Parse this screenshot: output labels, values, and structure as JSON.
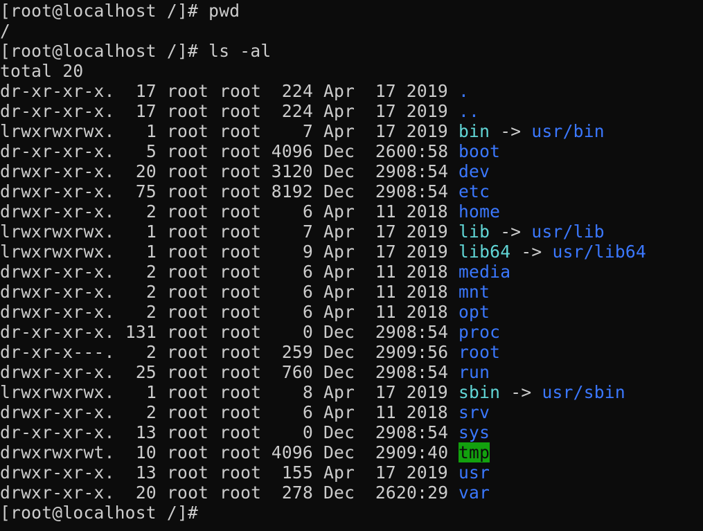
{
  "terminal": {
    "prompt": "[root@localhost /]#",
    "command1": "pwd",
    "output1": "/",
    "command2": "ls -al",
    "total": "total 20",
    "colors": {
      "background": "#0c0c0c",
      "text": "#cccccc",
      "directory": "#3b78ff",
      "symlink": "#61d6d6",
      "sticky_bg": "#13a10e"
    },
    "entries": [
      {
        "perms": "dr-xr-xr-x.",
        "links": "17",
        "owner": "root",
        "group": "root",
        "size": "224",
        "month": "Apr",
        "day": "17",
        "time": "2019",
        "name": ".",
        "kind": "dir",
        "target": ""
      },
      {
        "perms": "dr-xr-xr-x.",
        "links": "17",
        "owner": "root",
        "group": "root",
        "size": "224",
        "month": "Apr",
        "day": "17",
        "time": "2019",
        "name": "..",
        "kind": "dir",
        "target": ""
      },
      {
        "perms": "lrwxrwxrwx.",
        "links": "1",
        "owner": "root",
        "group": "root",
        "size": "7",
        "month": "Apr",
        "day": "17",
        "time": "2019",
        "name": "bin",
        "kind": "link",
        "target": "usr/bin"
      },
      {
        "perms": "dr-xr-xr-x.",
        "links": "5",
        "owner": "root",
        "group": "root",
        "size": "4096",
        "month": "Dec",
        "day": "26",
        "time": "00:58",
        "name": "boot",
        "kind": "dir",
        "target": ""
      },
      {
        "perms": "drwxr-xr-x.",
        "links": "20",
        "owner": "root",
        "group": "root",
        "size": "3120",
        "month": "Dec",
        "day": "29",
        "time": "08:54",
        "name": "dev",
        "kind": "dir",
        "target": ""
      },
      {
        "perms": "drwxr-xr-x.",
        "links": "75",
        "owner": "root",
        "group": "root",
        "size": "8192",
        "month": "Dec",
        "day": "29",
        "time": "08:54",
        "name": "etc",
        "kind": "dir",
        "target": ""
      },
      {
        "perms": "drwxr-xr-x.",
        "links": "2",
        "owner": "root",
        "group": "root",
        "size": "6",
        "month": "Apr",
        "day": "11",
        "time": "2018",
        "name": "home",
        "kind": "dir",
        "target": ""
      },
      {
        "perms": "lrwxrwxrwx.",
        "links": "1",
        "owner": "root",
        "group": "root",
        "size": "7",
        "month": "Apr",
        "day": "17",
        "time": "2019",
        "name": "lib",
        "kind": "link",
        "target": "usr/lib"
      },
      {
        "perms": "lrwxrwxrwx.",
        "links": "1",
        "owner": "root",
        "group": "root",
        "size": "9",
        "month": "Apr",
        "day": "17",
        "time": "2019",
        "name": "lib64",
        "kind": "link",
        "target": "usr/lib64"
      },
      {
        "perms": "drwxr-xr-x.",
        "links": "2",
        "owner": "root",
        "group": "root",
        "size": "6",
        "month": "Apr",
        "day": "11",
        "time": "2018",
        "name": "media",
        "kind": "dir",
        "target": ""
      },
      {
        "perms": "drwxr-xr-x.",
        "links": "2",
        "owner": "root",
        "group": "root",
        "size": "6",
        "month": "Apr",
        "day": "11",
        "time": "2018",
        "name": "mnt",
        "kind": "dir",
        "target": ""
      },
      {
        "perms": "drwxr-xr-x.",
        "links": "2",
        "owner": "root",
        "group": "root",
        "size": "6",
        "month": "Apr",
        "day": "11",
        "time": "2018",
        "name": "opt",
        "kind": "dir",
        "target": ""
      },
      {
        "perms": "dr-xr-xr-x.",
        "links": "131",
        "owner": "root",
        "group": "root",
        "size": "0",
        "month": "Dec",
        "day": "29",
        "time": "08:54",
        "name": "proc",
        "kind": "dir",
        "target": ""
      },
      {
        "perms": "dr-xr-x---.",
        "links": "2",
        "owner": "root",
        "group": "root",
        "size": "259",
        "month": "Dec",
        "day": "29",
        "time": "09:56",
        "name": "root",
        "kind": "dir",
        "target": ""
      },
      {
        "perms": "drwxr-xr-x.",
        "links": "25",
        "owner": "root",
        "group": "root",
        "size": "760",
        "month": "Dec",
        "day": "29",
        "time": "08:54",
        "name": "run",
        "kind": "dir",
        "target": ""
      },
      {
        "perms": "lrwxrwxrwx.",
        "links": "1",
        "owner": "root",
        "group": "root",
        "size": "8",
        "month": "Apr",
        "day": "17",
        "time": "2019",
        "name": "sbin",
        "kind": "link",
        "target": "usr/sbin"
      },
      {
        "perms": "drwxr-xr-x.",
        "links": "2",
        "owner": "root",
        "group": "root",
        "size": "6",
        "month": "Apr",
        "day": "11",
        "time": "2018",
        "name": "srv",
        "kind": "dir",
        "target": ""
      },
      {
        "perms": "dr-xr-xr-x.",
        "links": "13",
        "owner": "root",
        "group": "root",
        "size": "0",
        "month": "Dec",
        "day": "29",
        "time": "08:54",
        "name": "sys",
        "kind": "dir",
        "target": ""
      },
      {
        "perms": "drwxrwxrwt.",
        "links": "10",
        "owner": "root",
        "group": "root",
        "size": "4096",
        "month": "Dec",
        "day": "29",
        "time": "09:40",
        "name": "tmp",
        "kind": "sticky",
        "target": ""
      },
      {
        "perms": "drwxr-xr-x.",
        "links": "13",
        "owner": "root",
        "group": "root",
        "size": "155",
        "month": "Apr",
        "day": "17",
        "time": "2019",
        "name": "usr",
        "kind": "dir",
        "target": ""
      },
      {
        "perms": "drwxr-xr-x.",
        "links": "20",
        "owner": "root",
        "group": "root",
        "size": "278",
        "month": "Dec",
        "day": "26",
        "time": "20:29",
        "name": "var",
        "kind": "dir",
        "target": ""
      }
    ]
  }
}
